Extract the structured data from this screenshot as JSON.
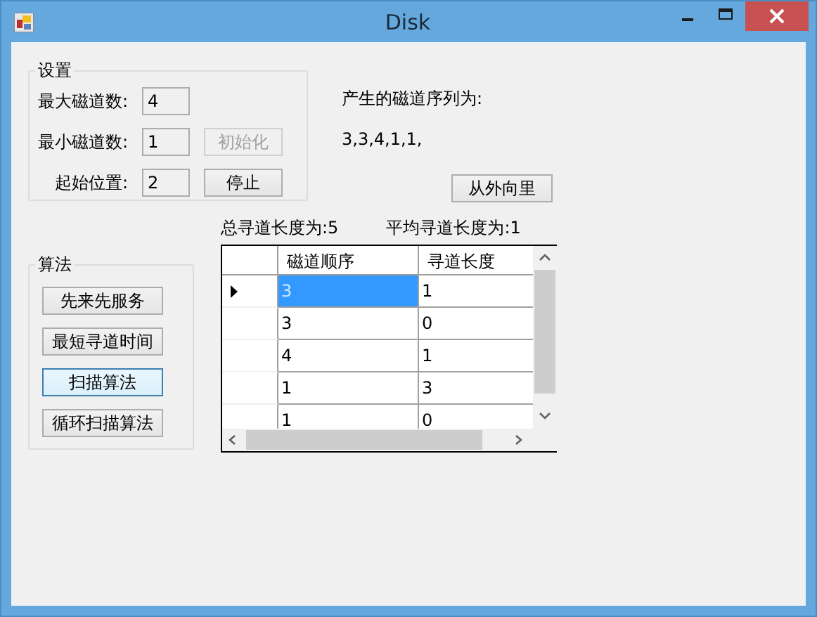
{
  "window": {
    "title": "Disk"
  },
  "settings": {
    "title": "设置",
    "fields": [
      {
        "label": "最大磁道数:",
        "value": "4"
      },
      {
        "label": "最小磁道数:",
        "value": "1"
      },
      {
        "label": "起始位置:",
        "value": "2"
      }
    ],
    "buttons": [
      {
        "label": "初始化",
        "disabled": true
      },
      {
        "label": "停止",
        "disabled": false
      }
    ]
  },
  "sequence": {
    "label": "产生的磁道序列为:",
    "value": "3,3,4,1,1,",
    "button": "从外向里"
  },
  "algorithm": {
    "title": "算法",
    "buttons": [
      {
        "label": "先来先服务",
        "selected": false
      },
      {
        "label": "最短寻道时间",
        "selected": false
      },
      {
        "label": "扫描算法",
        "selected": true
      },
      {
        "label": "循环扫描算法",
        "selected": false
      }
    ]
  },
  "stats": [
    "总寻道长度为:5",
    "平均寻道长度为:1"
  ],
  "table": {
    "columns": [
      "磁道顺序",
      "寻道长度"
    ],
    "rows": [
      {
        "cells": [
          "3",
          "1"
        ],
        "selected": true
      },
      {
        "cells": [
          "3",
          "0"
        ],
        "selected": false
      },
      {
        "cells": [
          "4",
          "1"
        ],
        "selected": false
      },
      {
        "cells": [
          "1",
          "3"
        ],
        "selected": false
      },
      {
        "cells": [
          "1",
          "0"
        ],
        "selected": false
      }
    ]
  }
}
